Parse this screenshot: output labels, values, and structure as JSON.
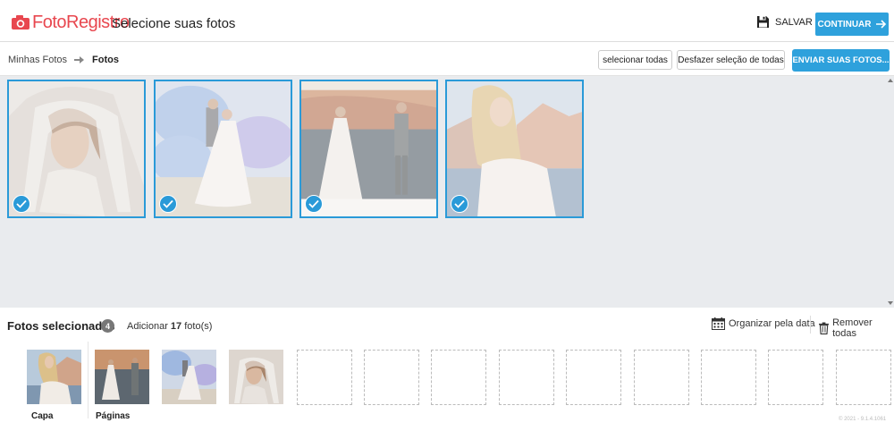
{
  "header": {
    "logo_text": "FotoRegistro",
    "page_title": "Selecione suas fotos",
    "save_label": "SALVAR",
    "continue_label": "CONTINUAR",
    "brand_color": "#e8474f",
    "accent_color": "#2ea1dc"
  },
  "toolbar": {
    "breadcrumb": [
      "Minhas Fotos",
      "Fotos"
    ],
    "select_all_label": "selecionar todas",
    "undo_selection_label": "Desfazer seleção de todas",
    "upload_label": "ENVIAR SUAS FOTOS..."
  },
  "gallery": {
    "photos": [
      {
        "subject": "bride with veil close-up",
        "selected": true
      },
      {
        "subject": "couple with blue smoke",
        "selected": true
      },
      {
        "subject": "couple walking by lake",
        "selected": true
      },
      {
        "subject": "bride in lace dress by lake",
        "selected": true
      }
    ]
  },
  "selected": {
    "title": "Fotos selecionadas",
    "count": "4",
    "add_prefix": "Adicionar",
    "add_number": "17",
    "add_suffix": "foto(s)",
    "organize_label": "Organizar pela data",
    "remove_label": "Remover todas",
    "cover_label": "Capa",
    "pages_label": "Páginas",
    "version": "© 2021 - 9.1.4.1061"
  }
}
